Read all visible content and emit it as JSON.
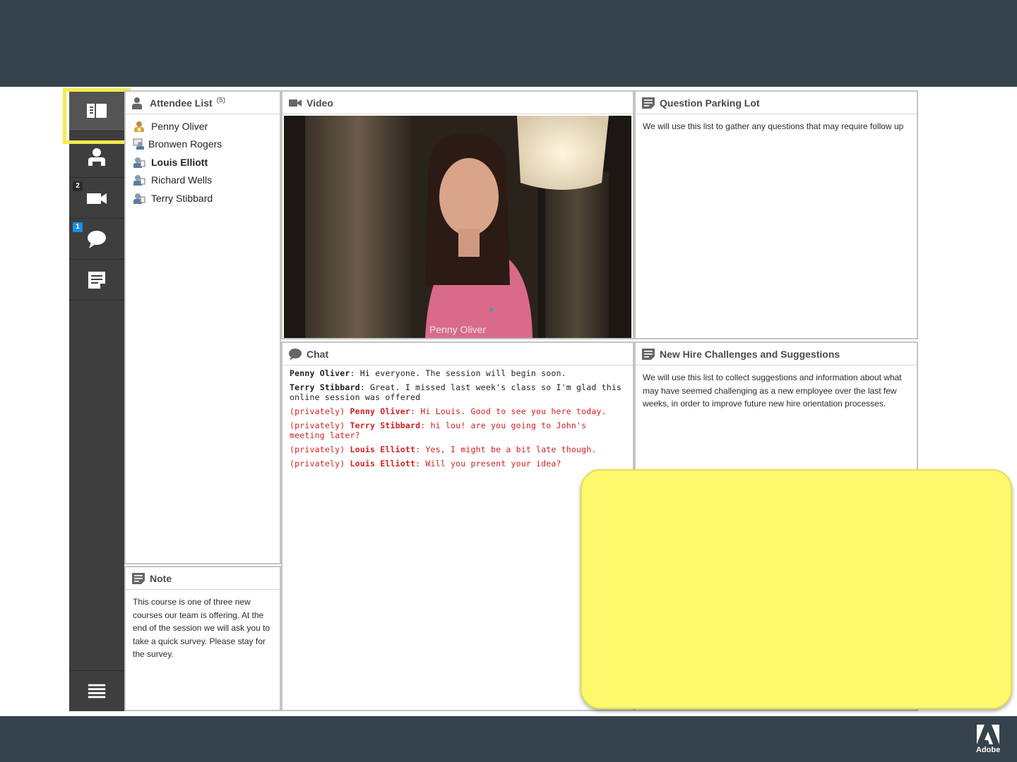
{
  "rail": {
    "badges": {
      "camera": "2",
      "chat": "1"
    },
    "icons": [
      "layout-icon",
      "attendee-icon",
      "camera-icon",
      "chat-icon",
      "note-icon",
      "menu-icon"
    ]
  },
  "attendees": {
    "title": "Attendee List",
    "count": "(5)",
    "items": [
      {
        "name": "Penny Oliver",
        "role": "host"
      },
      {
        "name": "Bronwen Rogers",
        "role": "presenter"
      },
      {
        "name": "Louis Elliott",
        "role": "participant"
      },
      {
        "name": "Richard Wells",
        "role": "participant"
      },
      {
        "name": "Terry Stibbard",
        "role": "participant"
      }
    ]
  },
  "note": {
    "title": "Note",
    "body": "This course is one of three new courses our team is offering. At the end of the session we will ask you to take a quick survey. Please stay for the survey."
  },
  "video": {
    "title": "Video",
    "caption": "Penny Oliver"
  },
  "chat": {
    "title": "Chat",
    "messages": [
      {
        "private": "",
        "who": "Penny Oliver",
        "text": ": Hi everyone. The session will begin soon."
      },
      {
        "private": "",
        "who": "Terry Stibbard",
        "text": ": Great. I missed last week's class so I'm glad this online session was offered"
      },
      {
        "private": "(privately) ",
        "who": "Penny Oliver",
        "text": ": Hi Louis. Good to see you here today."
      },
      {
        "private": "(privately) ",
        "who": "Terry Stibbard",
        "text": ": hi lou! are you going to John's meeting later?"
      },
      {
        "private": "(privately) ",
        "who": "Louis Elliott",
        "text": ": Yes, I might be a bit late though."
      },
      {
        "private": "(privately) ",
        "who": "Louis Elliott",
        "text": ": Will you present your idea?"
      }
    ]
  },
  "parking": {
    "title": "Question Parking Lot",
    "body": "We will use this list to gather any questions that may require follow up"
  },
  "challenges": {
    "title": "New Hire Challenges and Suggestions",
    "body": "We will use this list to collect suggestions and information about what may have seemed challenging as a new employee over the last few weeks, in order to improve future new hire orientation processes."
  },
  "brand": {
    "logo_text": "Adobe"
  },
  "colors": {
    "band": "#37434c",
    "rail": "#3e3e3e",
    "highlight": "#f3ea4a",
    "sticky": "#fef86c",
    "private_chat": "#d61f1f",
    "badge_blue": "#1a8ee6"
  }
}
